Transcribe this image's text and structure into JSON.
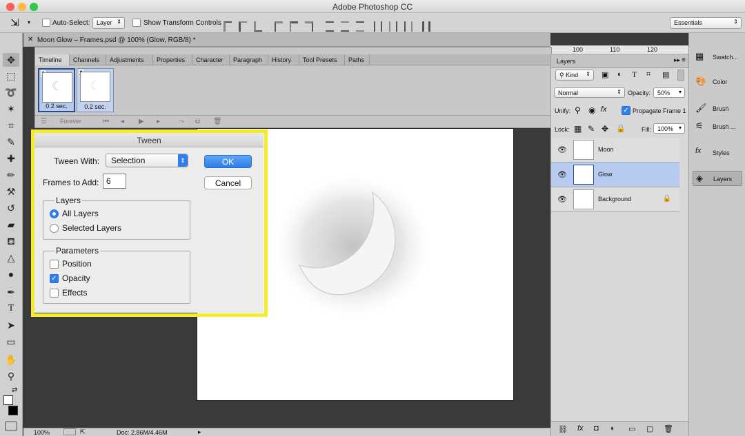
{
  "app": {
    "title": "Adobe Photoshop CC"
  },
  "options_bar": {
    "auto_select_label": "Auto-Select:",
    "auto_select_value": "Layer",
    "show_transform_label": "Show Transform Controls",
    "workspace": "Essentials"
  },
  "document": {
    "tab_title": "Moon Glow – Frames.psd @ 100% (Glow, RGB/8) *",
    "zoom": "100%",
    "doc_info": "Doc: 2.86M/4.46M"
  },
  "ruler": {
    "marks": [
      "100",
      "110",
      "120"
    ]
  },
  "panel_tabs": [
    "Timeline",
    "Channels",
    "Adjustments",
    "Properties",
    "Character",
    "Paragraph",
    "History",
    "Tool Presets",
    "Paths"
  ],
  "timeline": {
    "frames": [
      {
        "num": "1",
        "duration": "0.2 sec."
      },
      {
        "num": "2",
        "duration": "0.2 sec."
      }
    ],
    "loop": "Forever"
  },
  "tween_dialog": {
    "title": "Tween",
    "tween_with_label": "Tween With:",
    "tween_with_value": "Selection",
    "frames_to_add_label": "Frames to Add:",
    "frames_to_add_value": "6",
    "ok_label": "OK",
    "cancel_label": "Cancel",
    "layers_group": "Layers",
    "all_layers": "All Layers",
    "selected_layers": "Selected Layers",
    "params_group": "Parameters",
    "position": "Position",
    "opacity": "Opacity",
    "effects": "Effects"
  },
  "layers_panel": {
    "title": "Layers",
    "kind": "Kind",
    "blend_mode": "Normal",
    "opacity_label": "Opacity:",
    "opacity_value": "50%",
    "unify_label": "Unify:",
    "propagate_label": "Propagate Frame 1",
    "lock_label": "Lock:",
    "fill_label": "Fill:",
    "fill_value": "100%",
    "layers": [
      {
        "name": "Moon"
      },
      {
        "name": "Glow"
      },
      {
        "name": "Background"
      }
    ]
  },
  "dock": {
    "items": [
      "Swatch...",
      "Color",
      "Brush",
      "Brush ...",
      "Styles",
      "Layers"
    ]
  },
  "colors": {
    "highlight": "#f4ec2c",
    "accent": "#2f7ee9",
    "selected_row": "#b8ccf2"
  }
}
